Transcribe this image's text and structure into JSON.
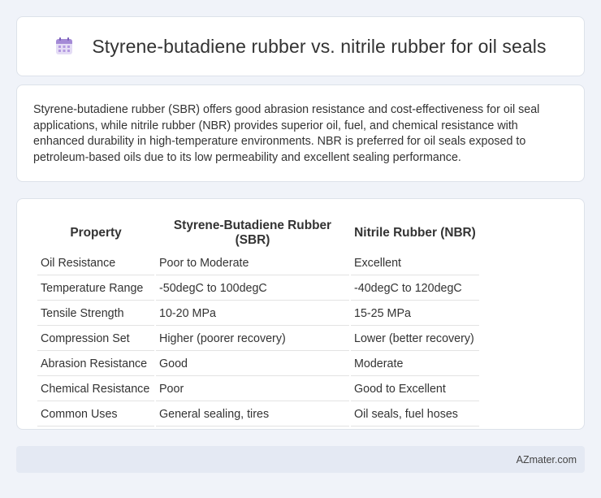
{
  "header": {
    "icon": "calendar-icon",
    "title": "Styrene-butadiene rubber vs. nitrile rubber for oil seals"
  },
  "summary": {
    "text": "Styrene-butadiene rubber (SBR) offers good abrasion resistance and cost-effectiveness for oil seal applications, while nitrile rubber (NBR) provides superior oil, fuel, and chemical resistance with enhanced durability in high-temperature environments. NBR is preferred for oil seals exposed to petroleum-based oils due to its low permeability and excellent sealing performance."
  },
  "table": {
    "headers": [
      "Property",
      "Styrene-Butadiene Rubber (SBR)",
      "Nitrile Rubber (NBR)"
    ],
    "rows": [
      [
        "Oil Resistance",
        "Poor to Moderate",
        "Excellent"
      ],
      [
        "Temperature Range",
        "-50degC to 100degC",
        "-40degC to 120degC"
      ],
      [
        "Tensile Strength",
        "10-20 MPa",
        "15-25 MPa"
      ],
      [
        "Compression Set",
        "Higher (poorer recovery)",
        "Lower (better recovery)"
      ],
      [
        "Abrasion Resistance",
        "Good",
        "Moderate"
      ],
      [
        "Chemical Resistance",
        "Poor",
        "Good to Excellent"
      ],
      [
        "Common Uses",
        "General sealing, tires",
        "Oil seals, fuel hoses"
      ]
    ]
  },
  "footer": {
    "text": "AZmater.com"
  }
}
